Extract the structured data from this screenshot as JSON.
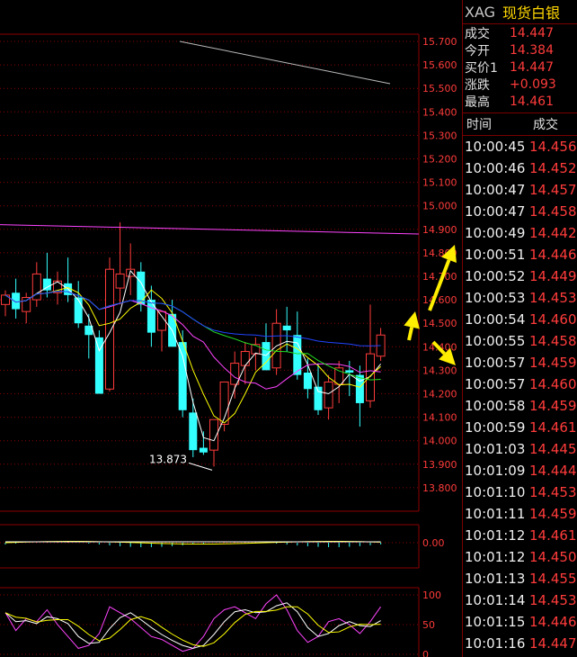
{
  "header": {
    "symbol": "XAG",
    "name": "现货白银"
  },
  "quote": [
    {
      "label": "成交",
      "value": "14.447"
    },
    {
      "label": "今开",
      "value": "14.384"
    },
    {
      "label": "买价1",
      "value": "14.447"
    },
    {
      "label": "涨跌",
      "value": "+0.093"
    },
    {
      "label": "最高",
      "value": "14.461"
    }
  ],
  "ticks_header": {
    "time": "时间",
    "price": "成交"
  },
  "ticks": [
    {
      "time": "10:00:45",
      "price": "14.456"
    },
    {
      "time": "10:00:46",
      "price": "14.452"
    },
    {
      "time": "10:00:47",
      "price": "14.457"
    },
    {
      "time": "10:00:47",
      "price": "14.458"
    },
    {
      "time": "10:00:49",
      "price": "14.442"
    },
    {
      "time": "10:00:51",
      "price": "14.446"
    },
    {
      "time": "10:00:52",
      "price": "14.449"
    },
    {
      "time": "10:00:53",
      "price": "14.453"
    },
    {
      "time": "10:00:54",
      "price": "14.460"
    },
    {
      "time": "10:00:55",
      "price": "14.458"
    },
    {
      "time": "10:00:57",
      "price": "14.459"
    },
    {
      "time": "10:00:57",
      "price": "14.460"
    },
    {
      "time": "10:00:58",
      "price": "14.459"
    },
    {
      "time": "10:00:59",
      "price": "14.461"
    },
    {
      "time": "10:01:03",
      "price": "14.445"
    },
    {
      "time": "10:01:09",
      "price": "14.444"
    },
    {
      "time": "10:01:10",
      "price": "14.453"
    },
    {
      "time": "10:01:11",
      "price": "14.459"
    },
    {
      "time": "10:01:12",
      "price": "14.461"
    },
    {
      "time": "10:01:12",
      "price": "14.450"
    },
    {
      "time": "10:01:13",
      "price": "14.455"
    },
    {
      "time": "10:01:14",
      "price": "14.453"
    },
    {
      "time": "10:01:15",
      "price": "14.446"
    },
    {
      "time": "10:01:16",
      "price": "14.447"
    }
  ],
  "chart_data": {
    "type": "candlestick",
    "price_axis": [
      "15.700",
      "15.600",
      "15.500",
      "15.400",
      "15.300",
      "15.200",
      "15.100",
      "15.000",
      "14.900",
      "14.800",
      "14.700",
      "14.600",
      "14.500",
      "14.400",
      "14.300",
      "14.200",
      "14.100",
      "14.000",
      "13.900",
      "13.800"
    ],
    "low_annotation": "13.873",
    "candles": [
      [
        14.58,
        14.64,
        14.53,
        14.62
      ],
      [
        14.63,
        14.69,
        14.52,
        14.56
      ],
      [
        14.55,
        14.63,
        14.5,
        14.61
      ],
      [
        14.6,
        14.76,
        14.57,
        14.71
      ],
      [
        14.69,
        14.8,
        14.61,
        14.64
      ],
      [
        14.63,
        14.72,
        14.58,
        14.68
      ],
      [
        14.67,
        14.78,
        14.59,
        14.62
      ],
      [
        14.61,
        14.68,
        14.48,
        14.5
      ],
      [
        14.49,
        14.54,
        14.35,
        14.45
      ],
      [
        14.44,
        14.47,
        14.2,
        14.2
      ],
      [
        14.22,
        14.78,
        14.21,
        14.73
      ],
      [
        14.65,
        14.93,
        14.58,
        14.71
      ],
      [
        14.7,
        14.84,
        14.62,
        14.73
      ],
      [
        14.72,
        14.76,
        14.55,
        14.58
      ],
      [
        14.6,
        14.66,
        14.4,
        14.46
      ],
      [
        14.47,
        14.52,
        14.38,
        14.55
      ],
      [
        14.54,
        14.6,
        14.42,
        14.4
      ],
      [
        14.42,
        14.47,
        14.1,
        14.13
      ],
      [
        14.12,
        14.18,
        13.93,
        13.96
      ],
      [
        13.97,
        14.04,
        13.94,
        13.95
      ],
      [
        13.96,
        14.09,
        13.89,
        14.09
      ],
      [
        14.07,
        14.2,
        14.04,
        14.25
      ],
      [
        14.24,
        14.38,
        14.18,
        14.33
      ],
      [
        14.32,
        14.42,
        14.24,
        14.38
      ],
      [
        14.37,
        14.44,
        14.3,
        14.41
      ],
      [
        14.42,
        14.5,
        14.31,
        14.3
      ],
      [
        14.31,
        14.56,
        14.28,
        14.5
      ],
      [
        14.49,
        14.57,
        14.38,
        14.47
      ],
      [
        14.45,
        14.55,
        14.26,
        14.28
      ],
      [
        14.29,
        14.35,
        14.18,
        14.22
      ],
      [
        14.23,
        14.33,
        14.11,
        14.13
      ],
      [
        14.14,
        14.28,
        14.09,
        14.25
      ],
      [
        14.24,
        14.34,
        14.16,
        14.31
      ],
      [
        14.3,
        14.34,
        14.19,
        14.29
      ],
      [
        14.28,
        14.32,
        14.06,
        14.16
      ],
      [
        14.17,
        14.58,
        14.14,
        14.37
      ],
      [
        14.36,
        14.48,
        14.34,
        14.45
      ]
    ],
    "series": [
      {
        "color": "#ffffff"
      },
      {
        "color": "#ffff00"
      },
      {
        "color": "#ff44ff"
      },
      {
        "color": "#22dd22"
      },
      {
        "color": "#2244ff"
      }
    ],
    "macd_label": "0.00",
    "kdj_axis": [
      "100",
      "50",
      "0"
    ],
    "colors": {
      "up": "#ff3b3b",
      "down": "#33ffff",
      "grid": "#8b0000",
      "axis_text": "#ff3b3b"
    }
  }
}
